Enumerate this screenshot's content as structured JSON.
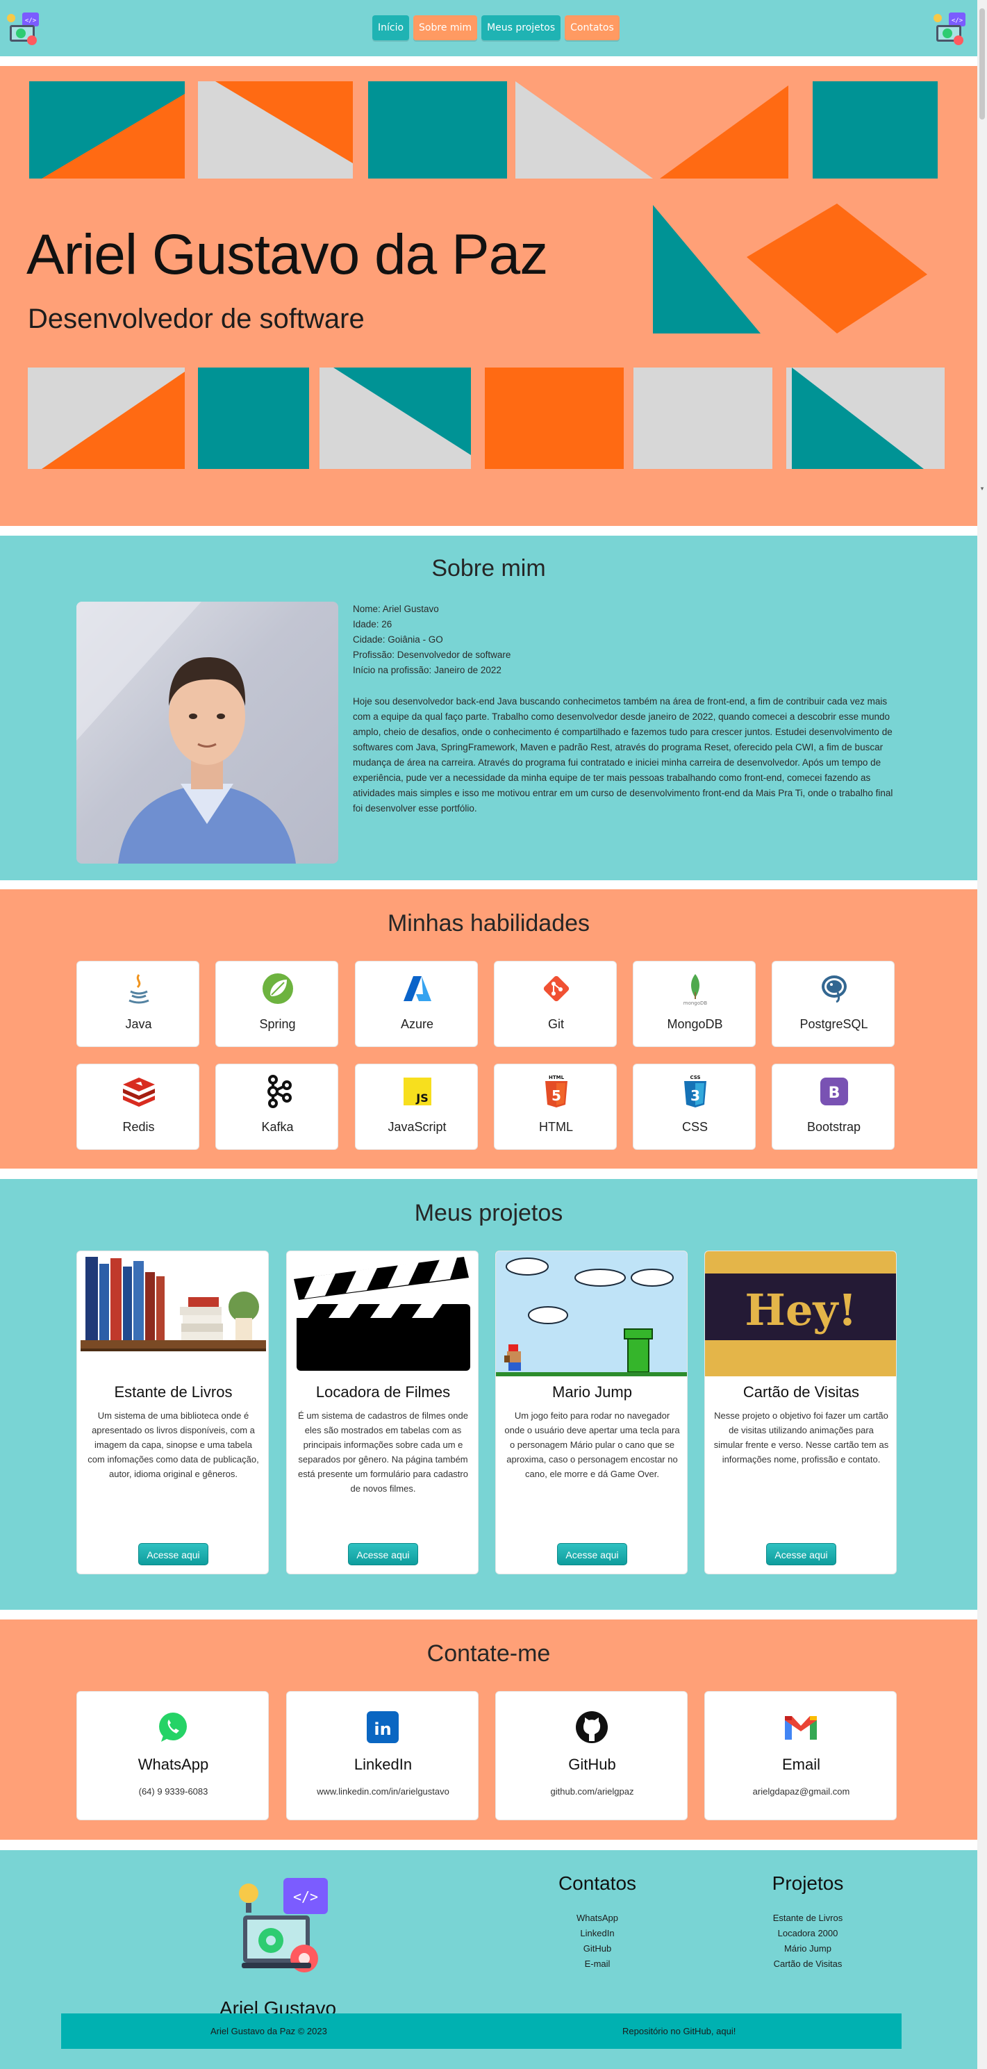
{
  "header": {
    "nav": [
      "Início",
      "Sobre mim",
      "Meus projetos",
      "Contatos"
    ],
    "logo_icon": "developer-laptop-logo"
  },
  "hero": {
    "name": "Ariel Gustavo da Paz",
    "role": "Desenvolvedor de software"
  },
  "about": {
    "title": "Sobre mim",
    "info": [
      "Nome: Ariel Gustavo",
      "Idade: 26",
      "Cidade: Goiânia - GO",
      "Profissão: Desenvolvedor de software",
      "Início na profissão: Janeiro de 2022"
    ],
    "bio": "Hoje sou desenvolvedor back-end Java buscando conhecimetos também na área de front-end, a fim de contribuir cada vez mais com a equipe da qual faço parte. Trabalho como desenvolvedor desde janeiro de 2022, quando comecei a descobrir esse mundo amplo, cheio de desafios, onde o conhecimento é compartilhado e fazemos tudo para crescer juntos. Estudei desenvolvimento de softwares com Java, SpringFramework, Maven e padrão Rest, através do programa Reset, oferecido pela CWI, a fim de buscar mudança de área na carreira. Através do programa fui contratado e iniciei minha carreira de desenvolvedor. Após um tempo de experiência, pude ver a necessidade da minha equipe de ter mais pessoas trabalhando como front-end, comecei fazendo as atividades mais simples e isso me motivou entrar em um curso de desenvolvimento front-end da Mais Pra Ti, onde o trabalho final foi desenvolver esse portfólio."
  },
  "skills": {
    "title": "Minhas habilidades",
    "items": [
      {
        "label": "Java",
        "icon": "java-icon"
      },
      {
        "label": "Spring",
        "icon": "spring-icon"
      },
      {
        "label": "Azure",
        "icon": "azure-icon"
      },
      {
        "label": "Git",
        "icon": "git-icon"
      },
      {
        "label": "MongoDB",
        "icon": "mongodb-icon"
      },
      {
        "label": "PostgreSQL",
        "icon": "postgresql-icon"
      },
      {
        "label": "Redis",
        "icon": "redis-icon"
      },
      {
        "label": "Kafka",
        "icon": "kafka-icon"
      },
      {
        "label": "JavaScript",
        "icon": "javascript-icon"
      },
      {
        "label": "HTML",
        "icon": "html-icon"
      },
      {
        "label": "CSS",
        "icon": "css-icon"
      },
      {
        "label": "Bootstrap",
        "icon": "bootstrap-icon"
      }
    ],
    "icon_text": {
      "mongodb": "mongoDB",
      "javascript": "JS",
      "html_tag": "HTML",
      "html_num": "5",
      "css_tag": "CSS",
      "css_num": "3",
      "bootstrap": "B"
    }
  },
  "projects": {
    "title": "Meus projetos",
    "button_label": "Acesse aqui",
    "items": [
      {
        "title": "Estante de Livros",
        "description": "Um sistema de uma biblioteca onde é apresentado os livros disponíveis, com a imagem da capa, sinopse e uma tabela com infomações como data de publicação, autor, idioma original e gêneros."
      },
      {
        "title": "Locadora de Filmes",
        "description": "É um sistema de cadastros de filmes onde eles são mostrados em tabelas com as principais informações sobre cada um e separados por gênero. Na página também está presente um formulário para cadastro de novos filmes."
      },
      {
        "title": "Mario Jump",
        "description": "Um jogo feito para rodar no navegador onde o usuário deve apertar uma tecla para o personagem Mário pular o cano que se aproxima, caso o personagem encostar no cano, ele morre e dá Game Over."
      },
      {
        "title": "Cartão de Visitas",
        "description": "Nesse projeto o objetivo foi fazer um cartão de visitas utilizando animações para simular frente e verso. Nesse cartão tem as informações nome, profissão e contato."
      }
    ],
    "card_image_text": "Hey!"
  },
  "contacts": {
    "title": "Contate-me",
    "items": [
      {
        "title": "WhatsApp",
        "value": "(64) 9 9339-6083",
        "icon": "whatsapp-icon"
      },
      {
        "title": "LinkedIn",
        "value": "www.linkedin.com/in/arielgustavo",
        "icon": "linkedin-icon"
      },
      {
        "title": "GitHub",
        "value": "github.com/arielgpaz",
        "icon": "github-icon"
      },
      {
        "title": "Email",
        "value": "arielgdapaz@gmail.com",
        "icon": "gmail-icon"
      }
    ],
    "linkedin_glyph": "in"
  },
  "footer": {
    "name": "Ariel Gustavo",
    "contacts_title": "Contatos",
    "contacts_links": [
      "WhatsApp",
      "LinkedIn",
      "GitHub",
      "E-mail"
    ],
    "projects_title": "Projetos",
    "projects_links": [
      "Estante de Livros",
      "Locadora 2000",
      "Mário Jump",
      "Cartão de Visitas"
    ],
    "copyright": "Ariel Gustavo da Paz © 2023",
    "repo_link": "Repositório no GitHub, aqui!",
    "logo_code_tag": "</>"
  },
  "colors": {
    "teal_section": "#79d4d4",
    "salmon_section": "#ffa077",
    "accent_teal": "#00b1b1",
    "accent_orange": "#ff6a13"
  }
}
